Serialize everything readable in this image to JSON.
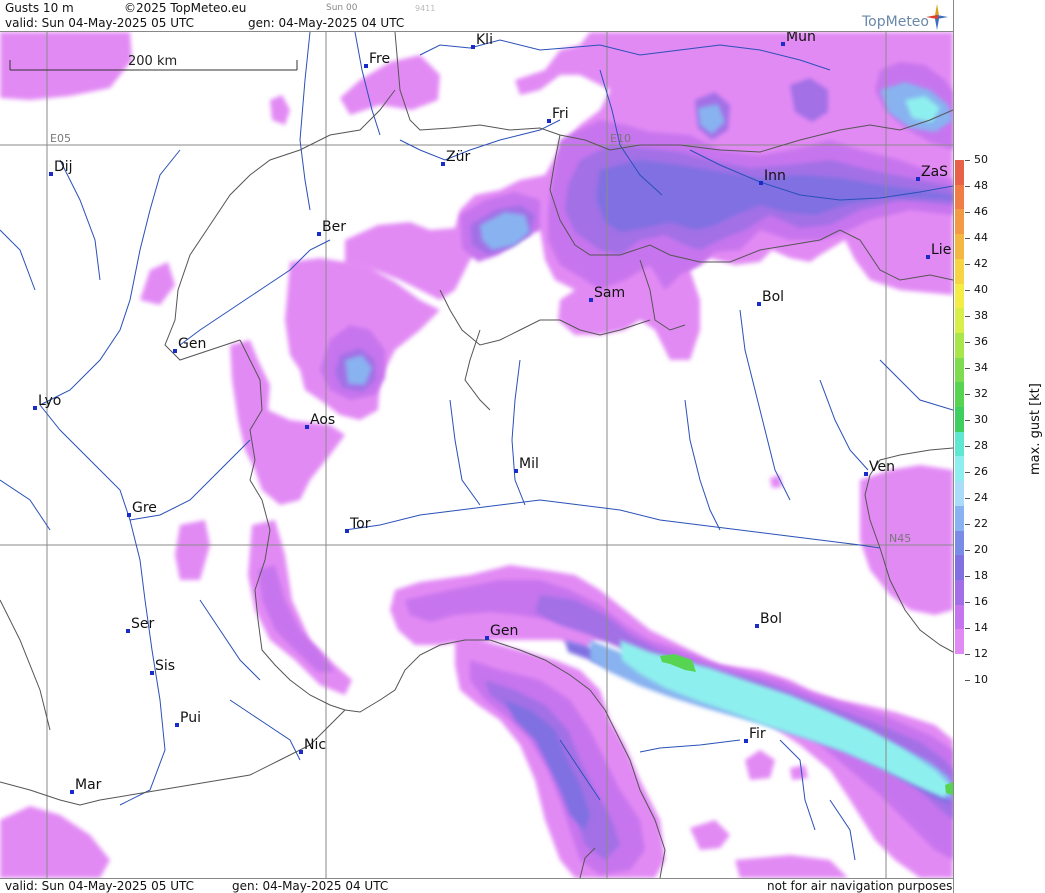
{
  "header": {
    "title": "Gusts 10 m",
    "copyright": "©2025 TopMeteo.eu",
    "run_label": "Sun 00",
    "code": "9411",
    "valid": "valid:  Sun  04-May-2025  05 UTC",
    "gen": "gen: 04-May-2025 04 UTC",
    "logo_text": "TopMeteo"
  },
  "footer": {
    "valid": "valid:  Sun  04-May-2025  05 UTC",
    "gen": "gen: 04-May-2025 04 UTC",
    "disclaimer": "not for air navigation purposes"
  },
  "map": {
    "scale_label": "200 km",
    "grid_labels": {
      "lon_e05": "E05",
      "lon_e10": "E10",
      "lat_n45": "N45"
    },
    "cities": [
      {
        "name": "Kli"
      },
      {
        "name": "Mun"
      },
      {
        "name": "Fre"
      },
      {
        "name": "Fri"
      },
      {
        "name": "Dij"
      },
      {
        "name": "Zür"
      },
      {
        "name": "Inn"
      },
      {
        "name": "ZaS"
      },
      {
        "name": "Ber"
      },
      {
        "name": "Lie"
      },
      {
        "name": "Sam"
      },
      {
        "name": "Bol"
      },
      {
        "name": "Gen"
      },
      {
        "name": "Lyo"
      },
      {
        "name": "Aos"
      },
      {
        "name": "Mil"
      },
      {
        "name": "Ven"
      },
      {
        "name": "Gre"
      },
      {
        "name": "Tor"
      },
      {
        "name": "Ser"
      },
      {
        "name": "Gen"
      },
      {
        "name": "Bol"
      },
      {
        "name": "Sis"
      },
      {
        "name": "Pui"
      },
      {
        "name": "Nic"
      },
      {
        "name": "Fir"
      },
      {
        "name": "Mar"
      }
    ]
  },
  "legend": {
    "label": "max. gust [kt]",
    "ticks": [
      "50",
      "48",
      "46",
      "44",
      "42",
      "40",
      "38",
      "36",
      "34",
      "32",
      "30",
      "28",
      "26",
      "24",
      "22",
      "20",
      "18",
      "16",
      "14",
      "12",
      "10"
    ],
    "colors": [
      "#e8624a",
      "#ef7d45",
      "#f29a44",
      "#f4b744",
      "#f6d444",
      "#f5ec46",
      "#d7ef48",
      "#a9e64c",
      "#7ddc4f",
      "#56d452",
      "#3fcf5f",
      "#5fe7d0",
      "#8ef0ee",
      "#a8dcf8",
      "#88b2f0",
      "#7a8ce6",
      "#8070e2",
      "#a36fe6",
      "#c775ee",
      "#e28af4"
    ]
  },
  "colors": {
    "gust_12": "#e28af4",
    "gust_14": "#c775ee",
    "gust_16": "#a36fe6",
    "gust_18": "#8070e2",
    "gust_22": "#88b2f0",
    "gust_26": "#8ef0ee",
    "gust_32": "#56d452",
    "river": "#2a50b8",
    "border": "#555555",
    "grid": "#8a8a8a",
    "city_marker": "#1a2cc8"
  }
}
